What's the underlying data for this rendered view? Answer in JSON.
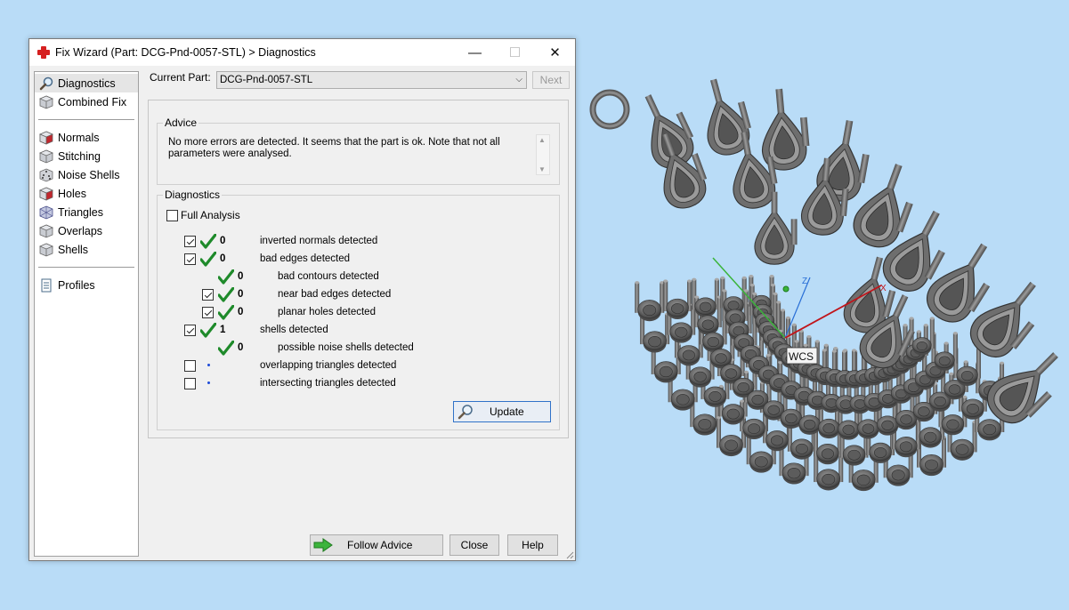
{
  "window": {
    "title": "Fix Wizard (Part: DCG-Pnd-0057-STL) > Diagnostics",
    "minimize_glyph": "—",
    "maximize_glyph": "☐",
    "close_glyph": "✕"
  },
  "sidebar": {
    "items": [
      {
        "label": "Diagnostics",
        "icon": "magnifier-icon",
        "selected": true
      },
      {
        "label": "Combined Fix",
        "icon": "cube-icon"
      },
      {
        "label": "Normals",
        "icon": "red-cube-icon"
      },
      {
        "label": "Stitching",
        "icon": "cube-icon"
      },
      {
        "label": "Noise Shells",
        "icon": "dice-icon"
      },
      {
        "label": "Holes",
        "icon": "red-cube-icon"
      },
      {
        "label": "Triangles",
        "icon": "wire-cube-icon"
      },
      {
        "label": "Overlaps",
        "icon": "cube-icon"
      },
      {
        "label": "Shells",
        "icon": "cube-icon"
      },
      {
        "label": "Profiles",
        "icon": "document-icon"
      }
    ]
  },
  "current_part": {
    "label": "Current Part:",
    "value": "DCG-Pnd-0057-STL",
    "next_label": "Next"
  },
  "advice": {
    "title": "Advice",
    "text": "No more errors are detected. It seems that the part is ok. Note that not all parameters were analysed."
  },
  "diagnostics": {
    "title": "Diagnostics",
    "full_analysis_label": "Full Analysis",
    "rows": [
      {
        "count": "0",
        "label": "inverted normals detected"
      },
      {
        "count": "0",
        "label": "bad edges detected"
      },
      {
        "count": "0",
        "label": "bad contours detected"
      },
      {
        "count": "0",
        "label": "near bad edges detected"
      },
      {
        "count": "0",
        "label": "planar holes detected"
      },
      {
        "count": "1",
        "label": "shells detected"
      },
      {
        "count": "0",
        "label": "possible noise shells detected"
      },
      {
        "count": "",
        "label": "overlapping triangles detected"
      },
      {
        "count": "",
        "label": "intersecting triangles detected"
      }
    ],
    "update_label": "Update"
  },
  "buttons": {
    "follow_advice": "Follow Advice",
    "close": "Close",
    "help": "Help"
  },
  "viewport": {
    "wcs_label": "WCS",
    "axis_z": "Z",
    "axis_x": "X",
    "colors": {
      "x_axis": "#c0151b",
      "y_axis": "#3ab43a",
      "z_axis": "#2a6fd6",
      "tick": "#1e8a2a"
    }
  }
}
